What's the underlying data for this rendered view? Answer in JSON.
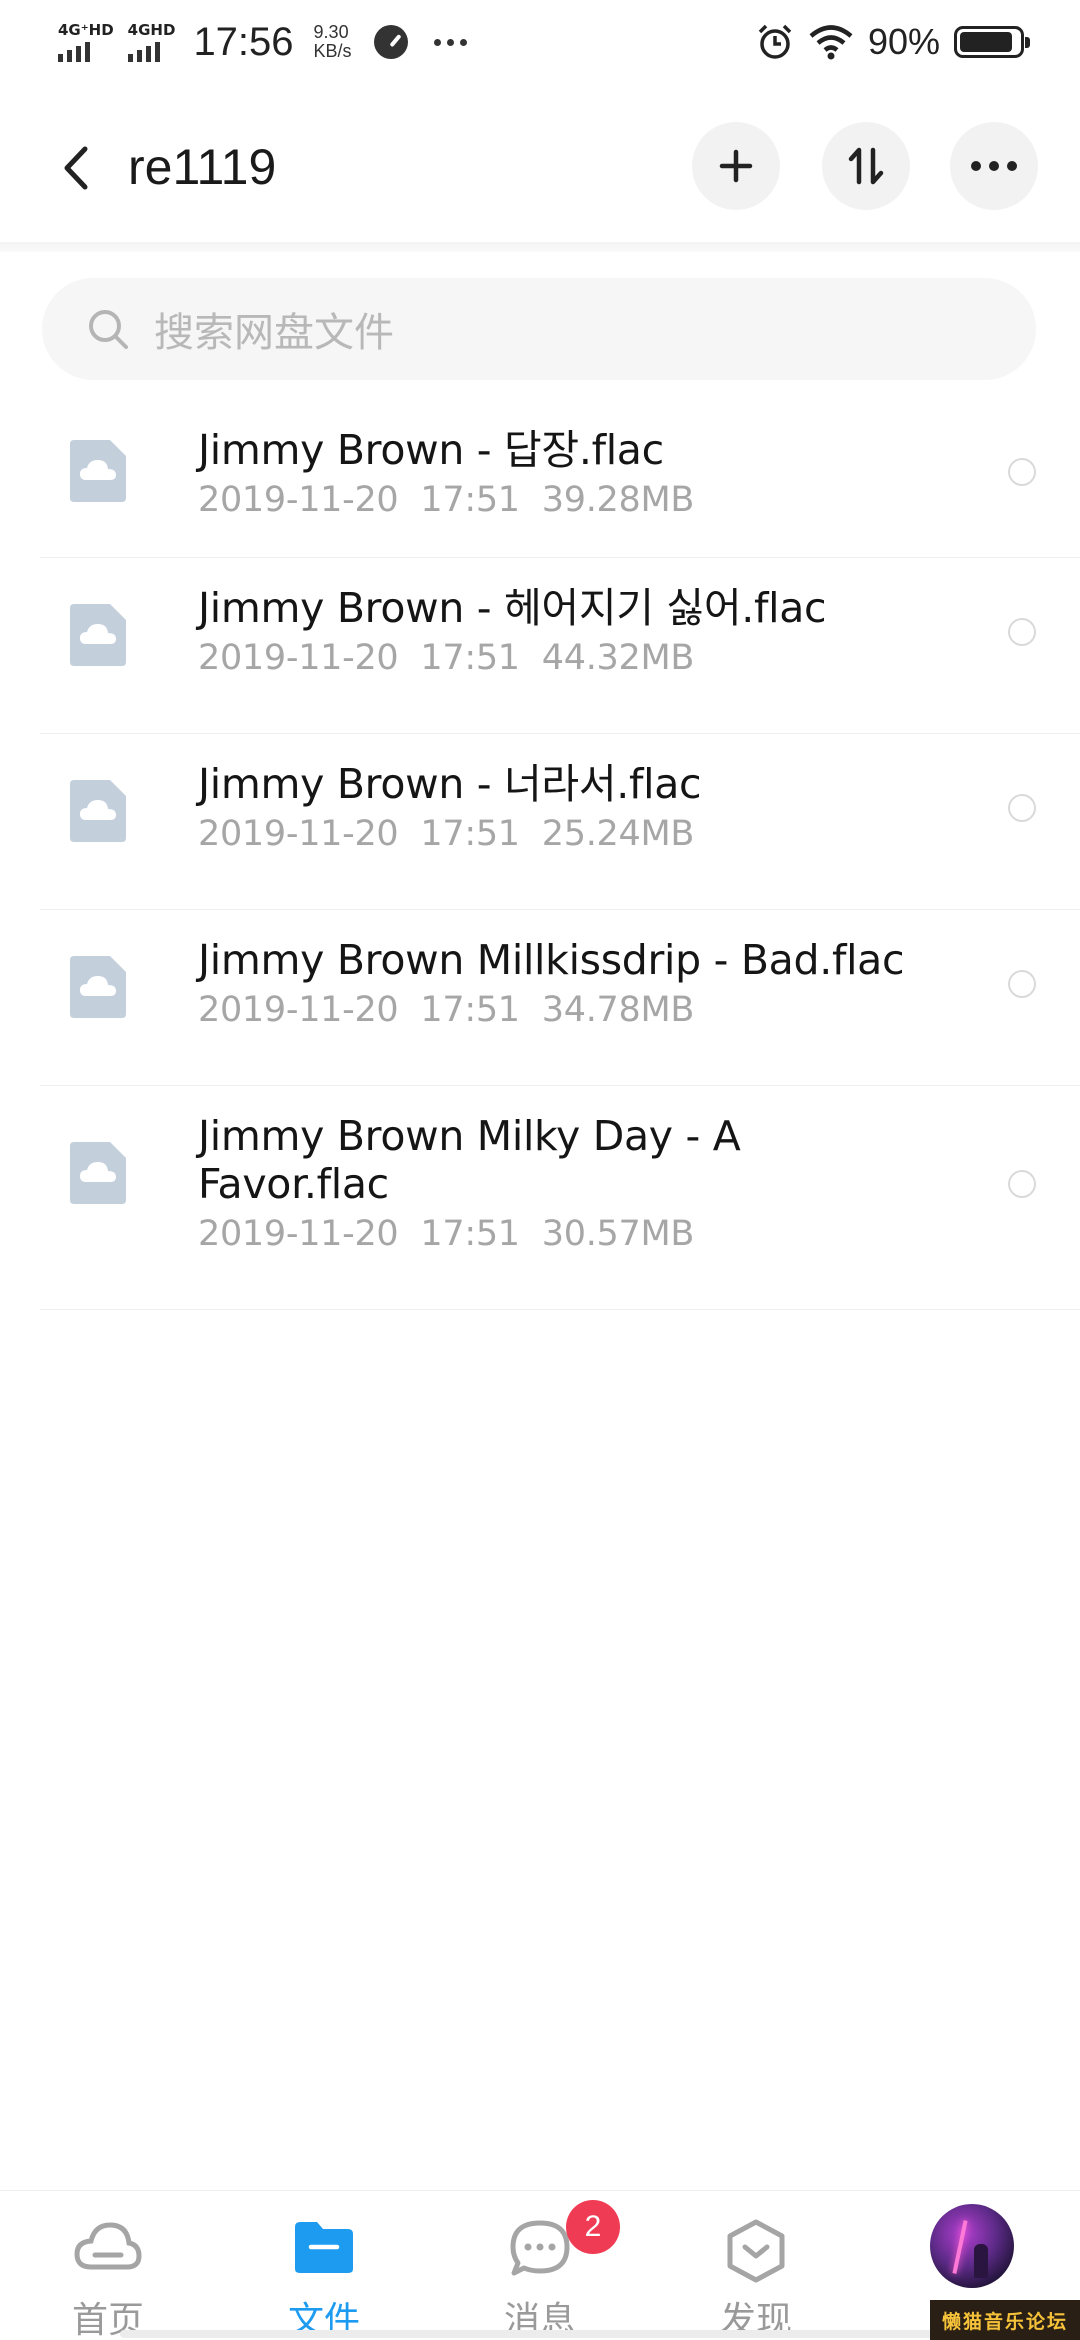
{
  "status_bar": {
    "network_1": "4G⁺HD",
    "network_2": "4GHD",
    "time": "17:56",
    "speed_value": "9.30",
    "speed_unit": "KB/s",
    "battery_percent": "90%",
    "battery_level": 0.9
  },
  "header": {
    "title": "re1119"
  },
  "search": {
    "placeholder": "搜索网盘文件"
  },
  "files": [
    {
      "name": "Jimmy Brown - 답장.flac",
      "date": "2019-11-20",
      "time": "17:51",
      "size": "39.28MB"
    },
    {
      "name": "Jimmy Brown - 헤어지기 싫어.flac",
      "date": "2019-11-20",
      "time": "17:51",
      "size": "44.32MB"
    },
    {
      "name": "Jimmy Brown - 너라서.flac",
      "date": "2019-11-20",
      "time": "17:51",
      "size": "25.24MB"
    },
    {
      "name": "Jimmy Brown Millkissdrip - Bad.flac",
      "date": "2019-11-20",
      "time": "17:51",
      "size": "34.78MB"
    },
    {
      "name": "Jimmy Brown Milky Day - A Favor.flac",
      "date": "2019-11-20",
      "time": "17:51",
      "size": "30.57MB"
    }
  ],
  "bottom_nav": {
    "items": [
      {
        "label": "首页",
        "icon": "cloud-icon"
      },
      {
        "label": "文件",
        "icon": "folder-icon"
      },
      {
        "label": "消息",
        "icon": "chat-bubble-icon"
      },
      {
        "label": "发现",
        "icon": "discover-hexagon-icon"
      }
    ],
    "message_badge": "2",
    "active_color": "#1d9bf0"
  },
  "watermark": "懒猫音乐论坛"
}
